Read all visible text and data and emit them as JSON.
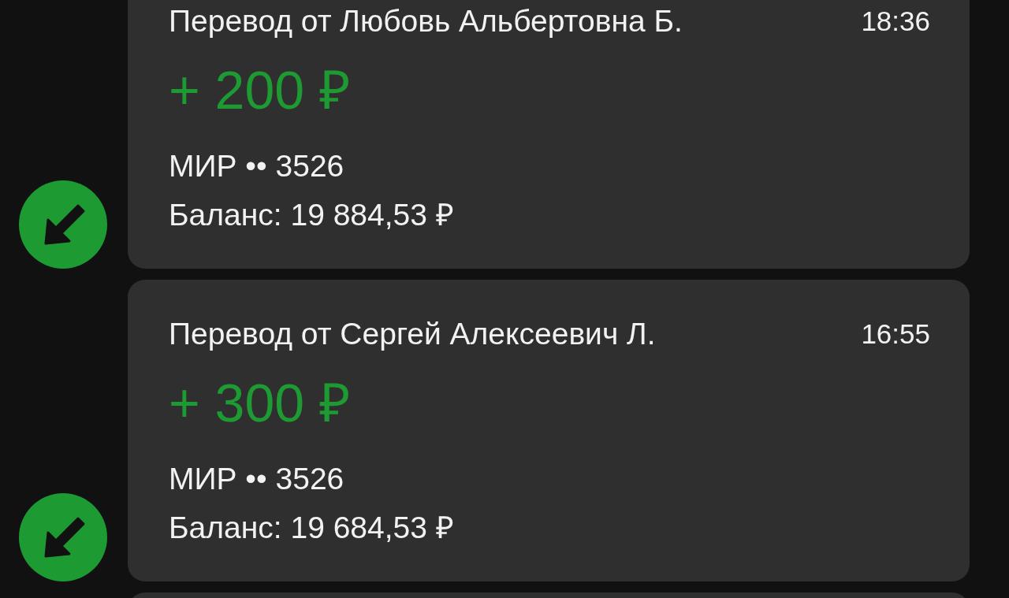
{
  "transactions": [
    {
      "title": "Перевод от Любовь Альбертовна Б.",
      "time": "18:36",
      "amount": "+ 200 ₽",
      "card": "МИР •• 3526",
      "balance": "Баланс: 19 884,53 ₽",
      "kind": "incoming"
    },
    {
      "title": "Перевод от Сергей Алексеевич Л.",
      "time": "16:55",
      "amount": "+ 300 ₽",
      "card": "МИР •• 3526",
      "balance": "Баланс: 19 684,53 ₽",
      "kind": "incoming"
    }
  ],
  "more_below": true
}
